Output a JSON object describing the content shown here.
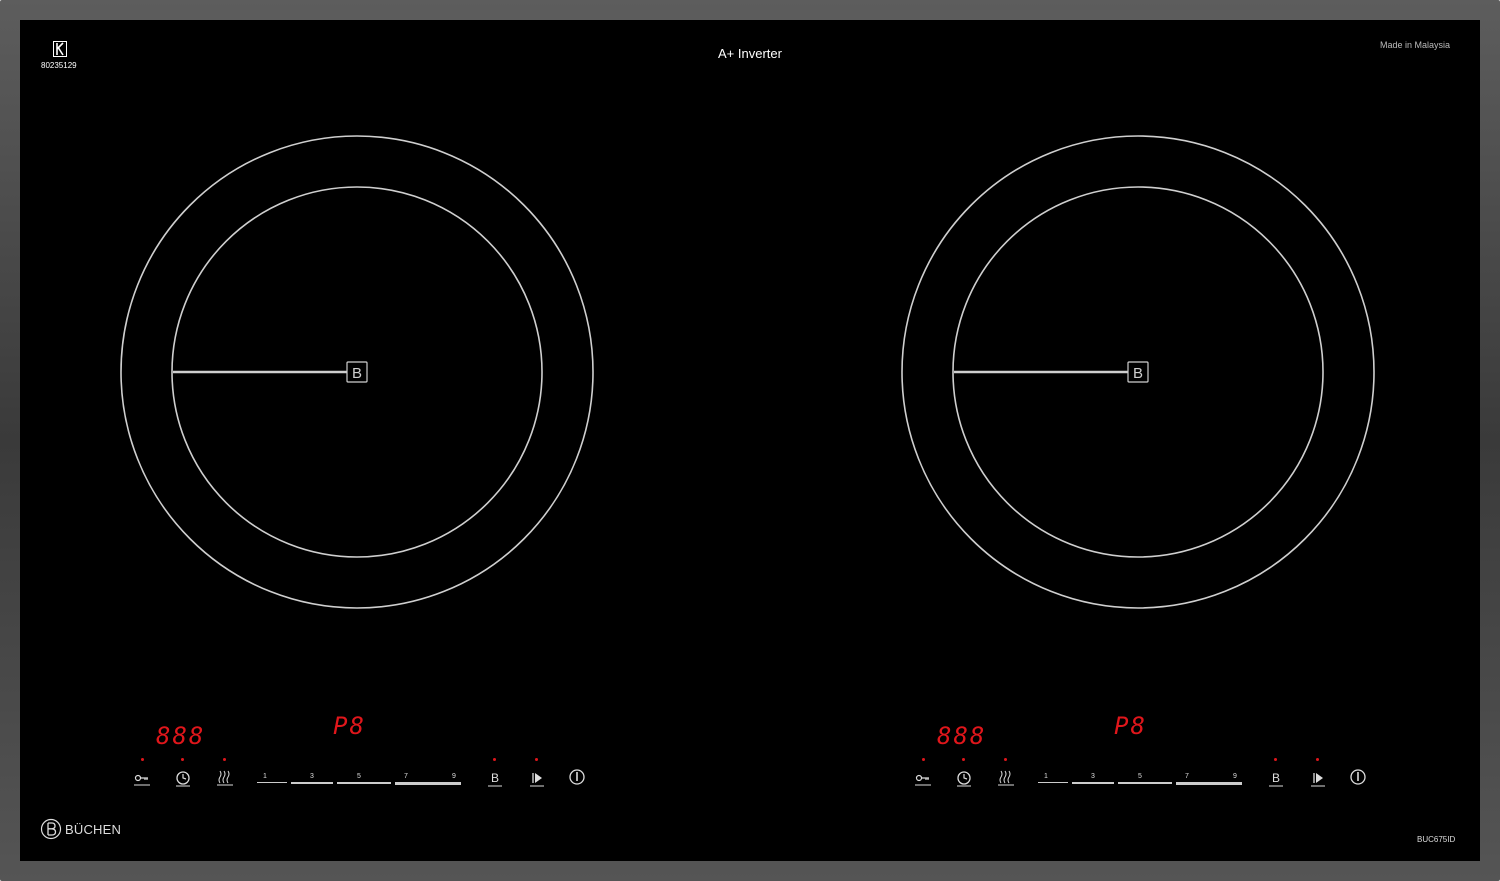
{
  "panel": {
    "certification_number": "80235129",
    "product_label": "A+ Inverter",
    "origin_label": "Made in Malaysia",
    "brand_name": "BÜCHEN",
    "model_number": "BUC675ID"
  },
  "zones": [
    {
      "name": "left",
      "boost_marker": "B",
      "timer_display": "888",
      "power_display": "P8",
      "slider_ticks": [
        "1",
        "3",
        "5",
        "7",
        "9"
      ],
      "controls": [
        "lock-icon",
        "timer-icon",
        "keep-warm-icon",
        "boost-button",
        "pause-play-icon",
        "power-icon"
      ]
    },
    {
      "name": "right",
      "boost_marker": "B",
      "timer_display": "888",
      "power_display": "P8",
      "slider_ticks": [
        "1",
        "3",
        "5",
        "7",
        "9"
      ],
      "controls": [
        "lock-icon",
        "timer-icon",
        "keep-warm-icon",
        "boost-button",
        "pause-play-icon",
        "power-icon"
      ]
    }
  ],
  "colors": {
    "glass": "#000000",
    "frame": "#4a4a4a",
    "ring": "#cfcfcf",
    "led": "#e0161b"
  }
}
